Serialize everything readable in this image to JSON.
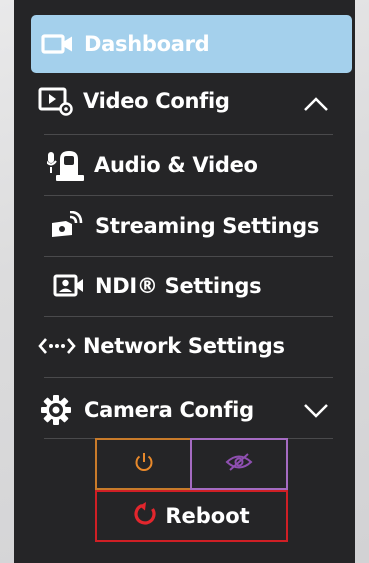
{
  "nav": {
    "dashboard": "Dashboard",
    "video_config": "Video Config",
    "audio_video": "Audio & Video",
    "streaming_settings": "Streaming Settings",
    "ndi_settings": "NDI® Settings",
    "network_settings": "Network Settings",
    "camera_config": "Camera Config"
  },
  "actions": {
    "reboot": "Reboot"
  },
  "colors": {
    "active_bg": "#a4d0ec",
    "panel_bg": "#252527",
    "power_border": "#c97b2a",
    "power_icon": "#e8892b",
    "visibility_border": "#a56bc2",
    "visibility_icon": "#8e4fb0",
    "reboot_border": "#d01f25",
    "reboot_icon": "#e3262d"
  },
  "icons": {
    "dashboard": "video-camera-icon",
    "video_config": "video-settings-icon",
    "audio_video": "webcam-microphone-icon",
    "streaming": "streaming-camera-icon",
    "ndi": "ndi-icon",
    "network": "network-code-icon",
    "camera_config": "gear-icon",
    "power": "power-icon",
    "visibility": "eye-slash-icon",
    "reboot": "reboot-icon"
  }
}
